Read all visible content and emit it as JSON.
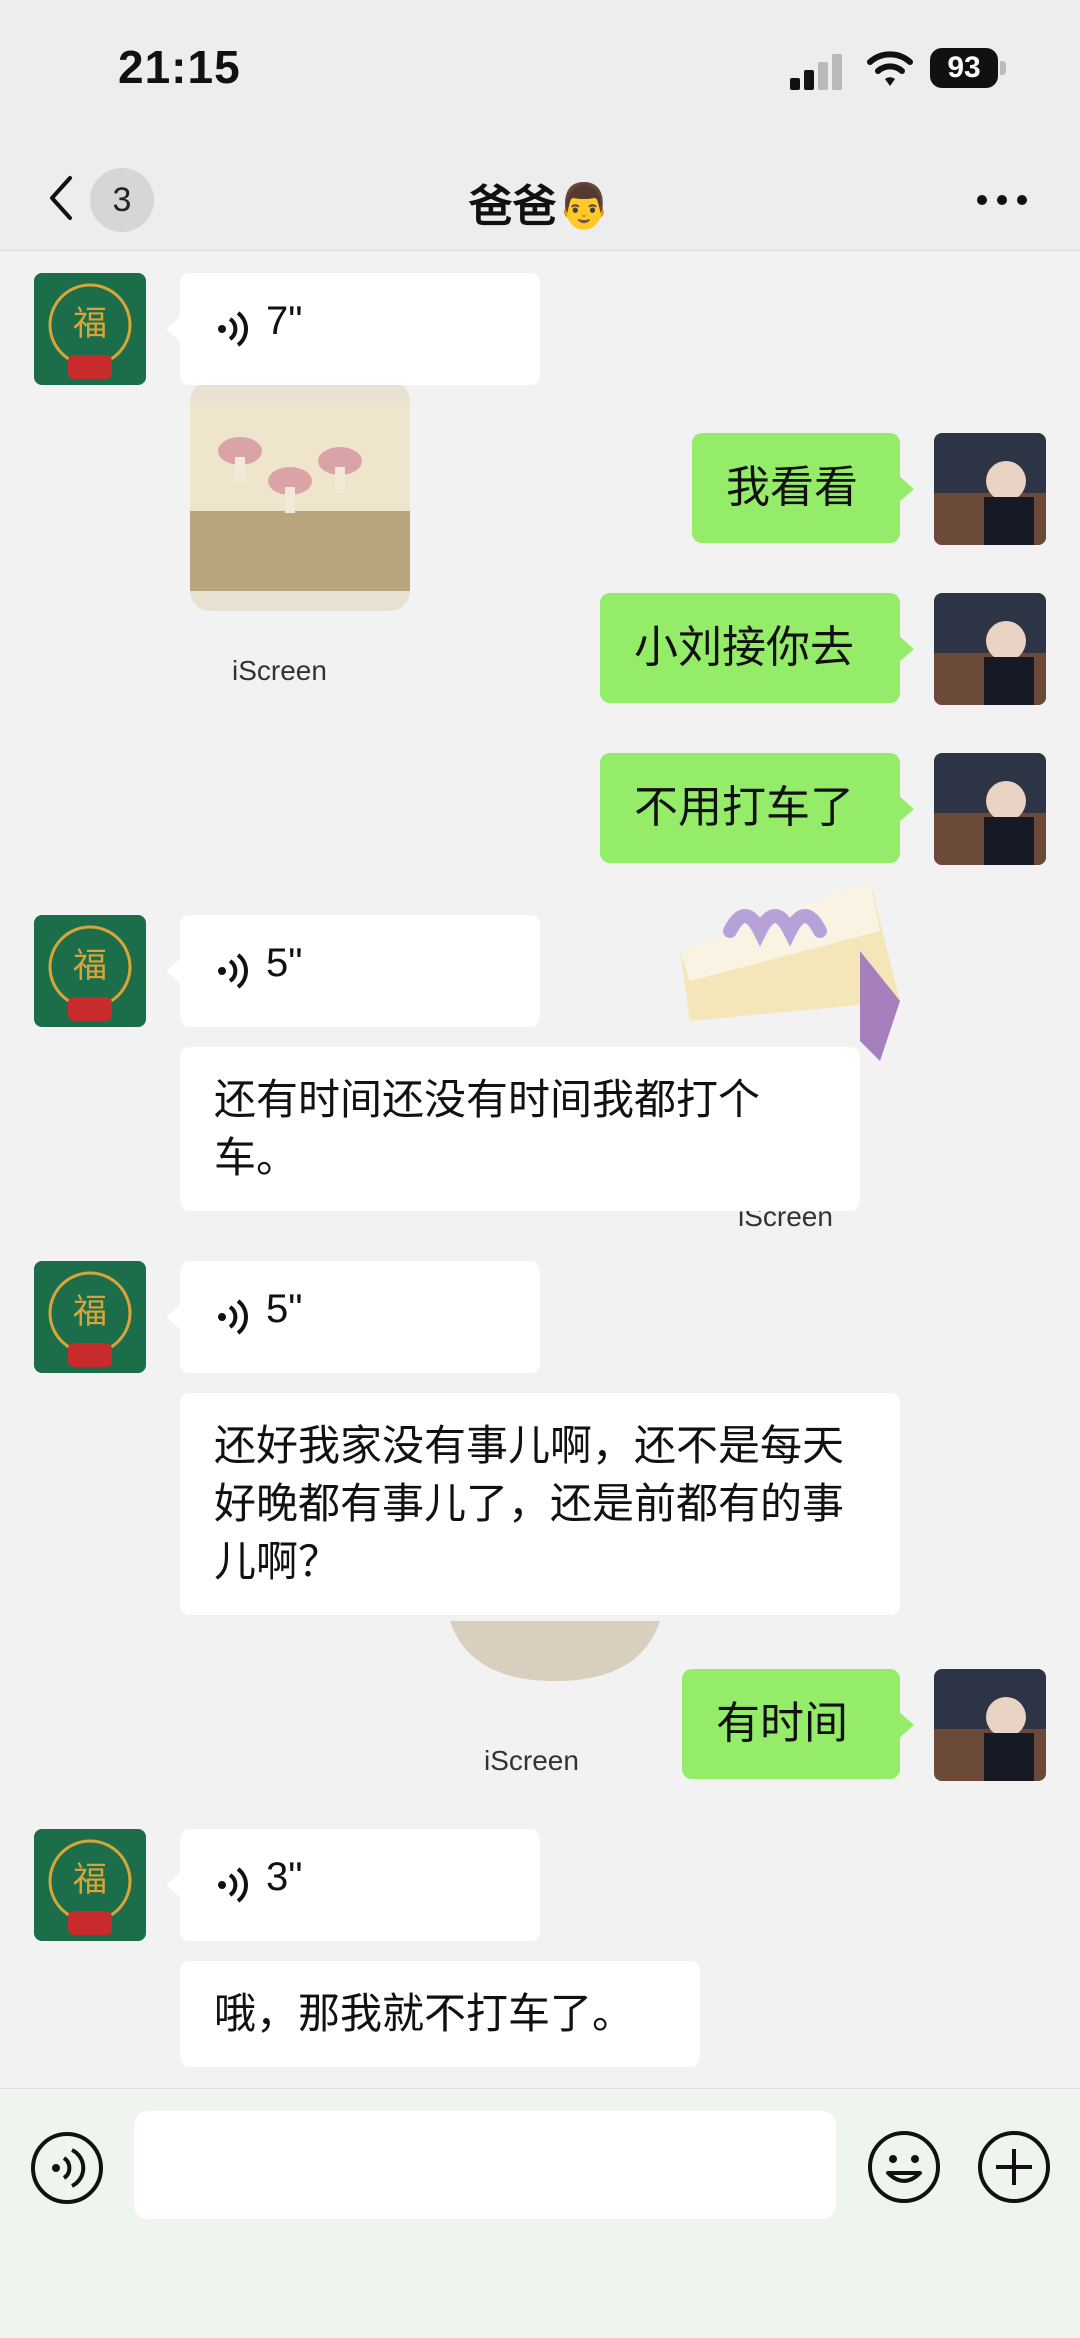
{
  "status_bar": {
    "time": "21:15",
    "battery": "93"
  },
  "nav": {
    "unread_count": "3",
    "title": "爸爸👨"
  },
  "messages": [
    {
      "type": "voice",
      "side": "left",
      "duration": "7\""
    },
    {
      "type": "text",
      "side": "right",
      "text": "我看看"
    },
    {
      "type": "text",
      "side": "right",
      "text": "小刘接你去"
    },
    {
      "type": "text",
      "side": "right",
      "text": "不用打车了"
    },
    {
      "type": "voice",
      "side": "left",
      "duration": "5\"",
      "transcript": "还有时间还没有时间我都打个车。"
    },
    {
      "type": "voice",
      "side": "left",
      "duration": "5\"",
      "transcript": "还好我家没有事儿啊，还不是每天好晚都有事儿了，还是前都有的事儿啊？"
    },
    {
      "type": "text",
      "side": "right",
      "text": "有时间"
    },
    {
      "type": "voice",
      "side": "left",
      "duration": "3\"",
      "transcript": "哦，那我就不打车了。"
    }
  ],
  "watermarks": [
    "iScreen",
    "iScreen",
    "iScreen"
  ],
  "colors": {
    "my_bubble": "#95ec69",
    "other_bubble": "#ffffff",
    "background": "#f2f2f2",
    "avatar_green": "#1c6e4a",
    "avatar_gold": "#d9a53a"
  },
  "icons": {
    "back": "chevron-left-icon",
    "more": "ellipsis-icon",
    "voice": "voice-wave-icon",
    "emoji": "smiley-icon",
    "plus": "plus-circle-icon"
  }
}
